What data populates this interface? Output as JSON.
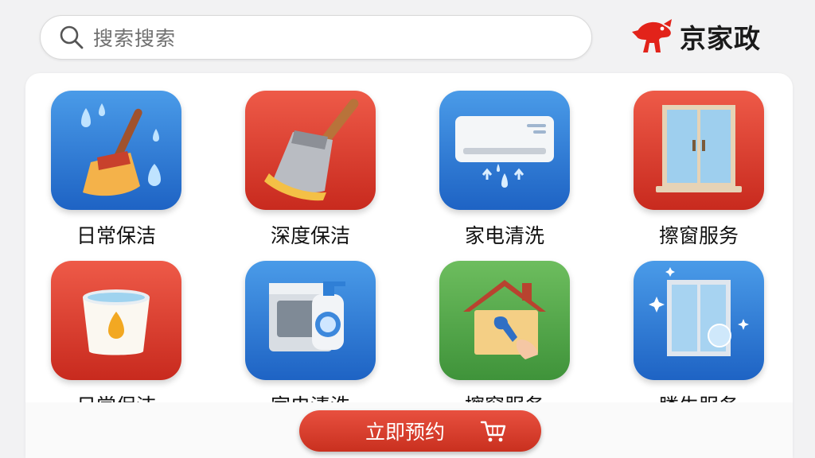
{
  "header": {
    "search_placeholder": "搜索搜索",
    "brand_name": "京家政",
    "search_icon": "search-icon",
    "brand_logo": "mascot-dog-logo"
  },
  "grid": {
    "items": [
      {
        "label": "日常保洁",
        "icon": "broom-water-drops-icon",
        "bg": "#2f7fd6"
      },
      {
        "label": "深度保洁",
        "icon": "duster-brush-icon",
        "bg": "#d93a2e"
      },
      {
        "label": "家电清洗",
        "icon": "air-conditioner-icon",
        "bg": "#2f7fd6"
      },
      {
        "label": "擦窗服务",
        "icon": "window-frame-icon",
        "bg": "#d93a2e"
      },
      {
        "label": "日常保洁",
        "icon": "bucket-drop-icon",
        "bg": "#d93a2e"
      },
      {
        "label": "家电清洗",
        "icon": "appliance-spray-icon",
        "bg": "#2f7fd6"
      },
      {
        "label": "擦窗服务",
        "icon": "house-wrench-icon",
        "bg": "#55a84a"
      },
      {
        "label": "䁖生服务",
        "icon": "sparkling-window-icon",
        "bg": "#2f7fd6"
      }
    ]
  },
  "cta": {
    "label": "立即预约",
    "icon": "cart-icon"
  },
  "colors": {
    "accent_red": "#d93a2e",
    "accent_blue": "#2f7fd6",
    "accent_green": "#55a84a"
  }
}
